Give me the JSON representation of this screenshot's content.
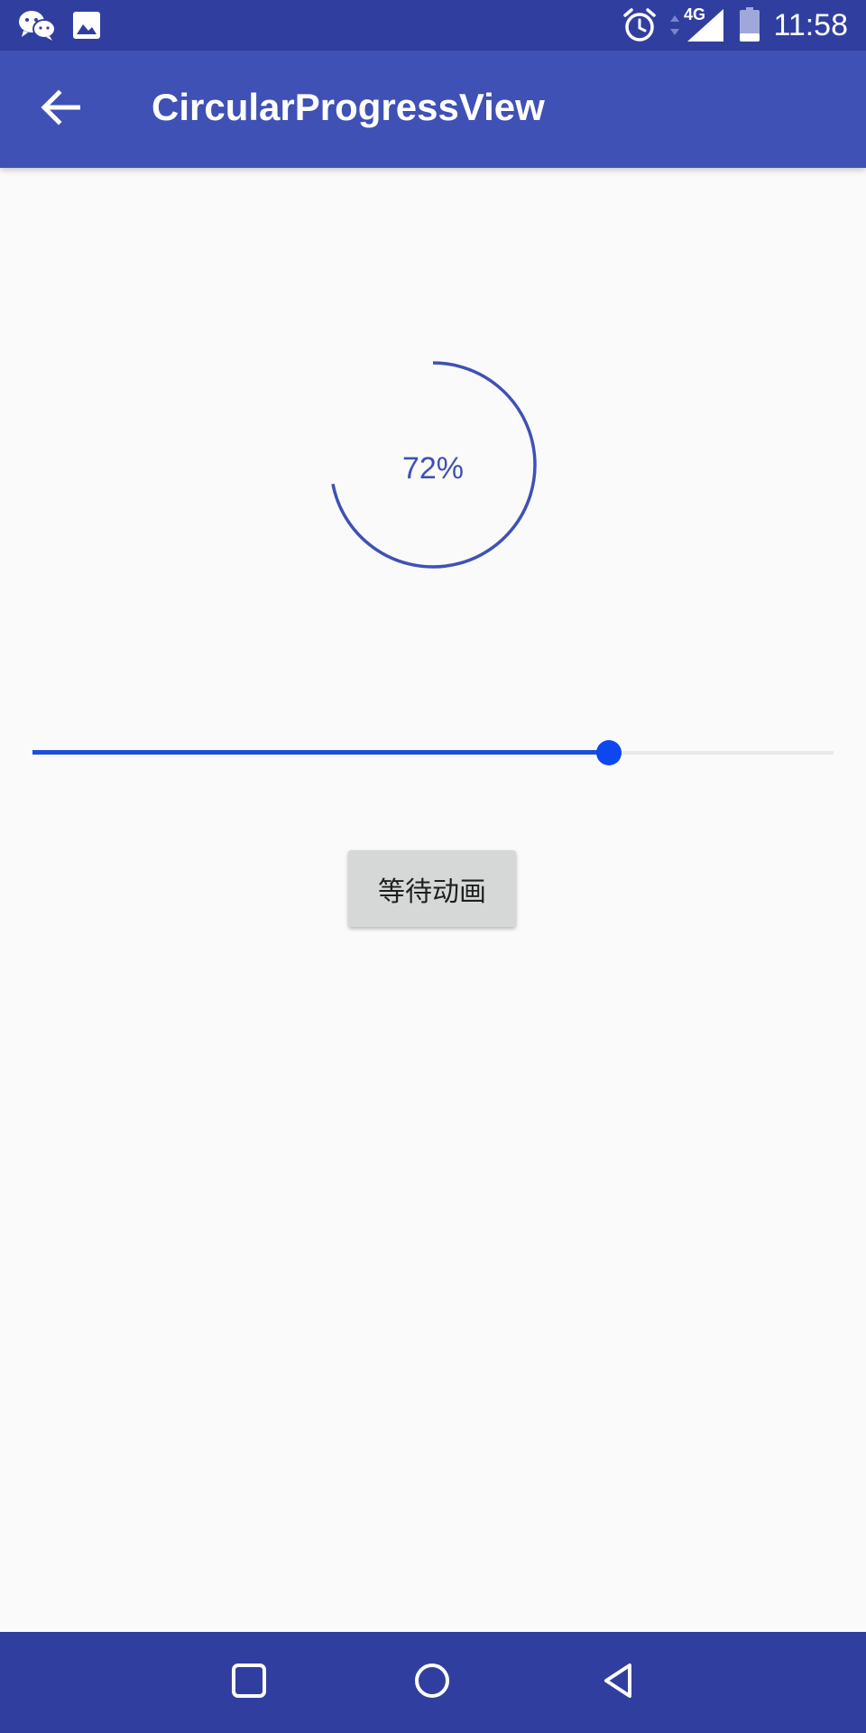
{
  "status_bar": {
    "time": "11:58",
    "network_label": "4G",
    "left_icons": [
      "wechat-icon",
      "image-icon"
    ],
    "right_icons": [
      "alarm-icon",
      "data-arrows-icon",
      "signal-icon",
      "battery-icon"
    ]
  },
  "app_bar": {
    "title": "CircularProgressView",
    "back_icon": "arrow-back-icon",
    "color": "#3f51b5"
  },
  "progress": {
    "value": 72,
    "text": "72%",
    "color": "#3f51b5"
  },
  "slider": {
    "value": 0.72,
    "color": "#1a4fd6"
  },
  "button": {
    "label": "等待动画"
  },
  "nav_bar": {
    "buttons": [
      "recents-square-icon",
      "home-circle-icon",
      "back-triangle-icon"
    ],
    "color": "#303f9f"
  }
}
